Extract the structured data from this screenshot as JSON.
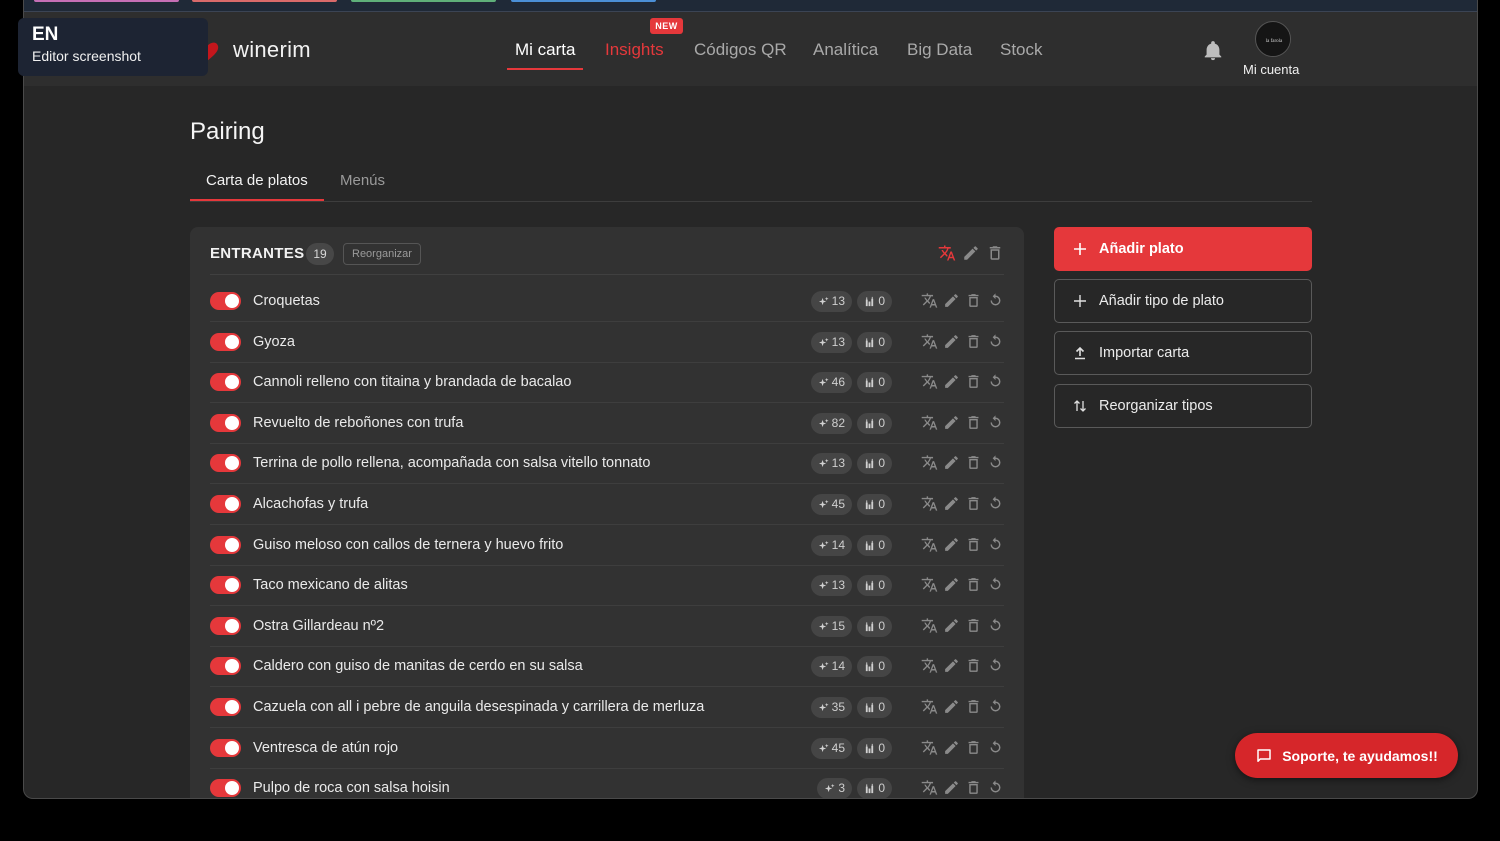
{
  "lang_badge": {
    "code": "EN",
    "label": "Editor screenshot"
  },
  "brand": {
    "name": "winerim"
  },
  "nav": {
    "items": [
      {
        "label": "Mi carta",
        "state": "active"
      },
      {
        "label": "Insights",
        "state": "highlight",
        "badge": "NEW"
      },
      {
        "label": "Códigos QR",
        "state": "normal"
      },
      {
        "label": "Analítica",
        "state": "normal"
      },
      {
        "label": "Big Data",
        "state": "normal"
      },
      {
        "label": "Stock",
        "state": "normal"
      }
    ],
    "account_label": "Mi cuenta",
    "avatar_text": "la farola"
  },
  "page": {
    "title": "Pairing",
    "tabs": [
      {
        "label": "Carta de platos"
      },
      {
        "label": "Menús"
      }
    ]
  },
  "section": {
    "title": "ENTRANTES",
    "count": "19",
    "reorder_label": "Reorganizar",
    "dishes": [
      {
        "name": "Croquetas",
        "ai": "13",
        "wines": "0"
      },
      {
        "name": "Gyoza",
        "ai": "13",
        "wines": "0"
      },
      {
        "name": "Cannoli relleno con titaina y brandada de bacalao",
        "ai": "46",
        "wines": "0"
      },
      {
        "name": "Revuelto de reboñones con trufa",
        "ai": "82",
        "wines": "0"
      },
      {
        "name": "Terrina de pollo rellena, acompañada con salsa vitello tonnato",
        "ai": "13",
        "wines": "0"
      },
      {
        "name": "Alcachofas y trufa",
        "ai": "45",
        "wines": "0"
      },
      {
        "name": "Guiso meloso con callos de ternera y huevo frito",
        "ai": "14",
        "wines": "0"
      },
      {
        "name": "Taco mexicano de alitas",
        "ai": "13",
        "wines": "0"
      },
      {
        "name": "Ostra Gillardeau nº2",
        "ai": "15",
        "wines": "0"
      },
      {
        "name": "Caldero con guiso de manitas de cerdo en su salsa",
        "ai": "14",
        "wines": "0"
      },
      {
        "name": "Cazuela con all i pebre de anguila desespinada y carrillera de merluza",
        "ai": "35",
        "wines": "0"
      },
      {
        "name": "Ventresca de atún rojo",
        "ai": "45",
        "wines": "0"
      },
      {
        "name": "Pulpo de roca con salsa hoisin",
        "ai": "3",
        "wines": "0"
      }
    ]
  },
  "actions": {
    "add_dish": "Añadir plato",
    "add_dish_type": "Añadir tipo de plato",
    "import_menu": "Importar carta",
    "reorder_types": "Reorganizar tipos"
  },
  "support": {
    "label": "Soporte, te ayudamos!!"
  },
  "colors": {
    "accent": "#e5383b",
    "background": "#272727",
    "card": "#323232"
  }
}
